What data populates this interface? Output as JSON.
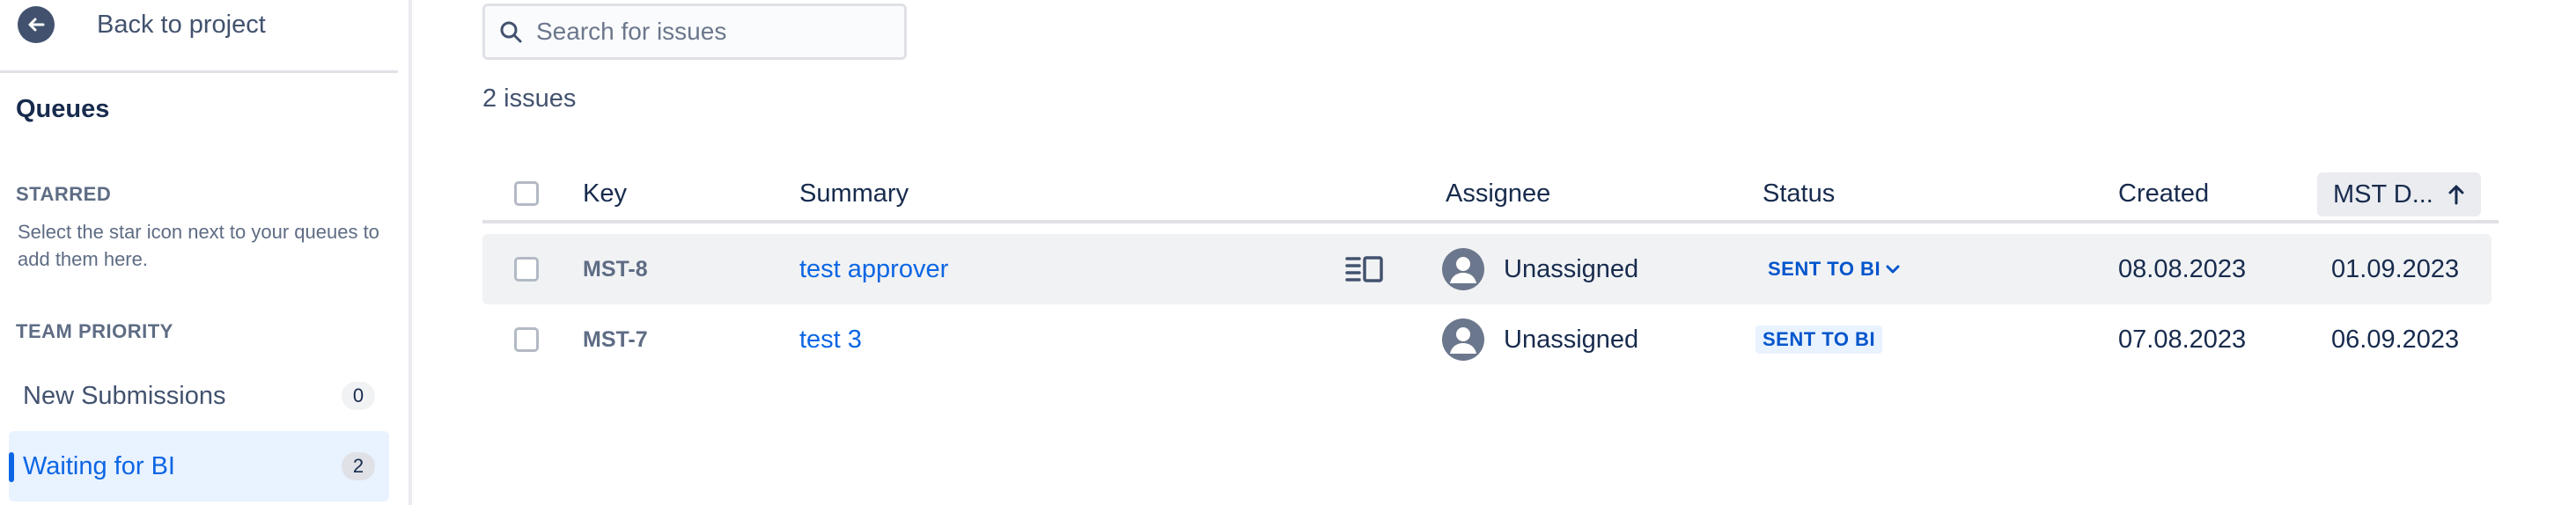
{
  "sidebar": {
    "back_label": "Back to project",
    "queues_title": "Queues",
    "starred_head": "STARRED",
    "starred_hint": "Select the star icon next to your queues to add them here.",
    "team_priority_head": "TEAM PRIORITY",
    "queues": [
      {
        "label": "New Submissions",
        "count": "0",
        "active": false
      },
      {
        "label": "Waiting for BI",
        "count": "2",
        "active": true
      }
    ]
  },
  "search": {
    "placeholder": "Search for issues",
    "value": ""
  },
  "issue_count": "2 issues",
  "table": {
    "headers": {
      "key": "Key",
      "summary": "Summary",
      "assignee": "Assignee",
      "status": "Status",
      "created": "Created",
      "due": "MST D..."
    },
    "rows": [
      {
        "key": "MST-8",
        "summary": "test approver",
        "assignee": "Unassigned",
        "status": "SENT TO BI",
        "created": "08.08.2023",
        "due": "01.09.2023"
      },
      {
        "key": "MST-7",
        "summary": "test 3",
        "assignee": "Unassigned",
        "status": "SENT TO BI",
        "created": "07.08.2023",
        "due": "06.09.2023"
      }
    ]
  },
  "colors": {
    "accent": "#0c66e4",
    "status_bg": "#e9f2ff",
    "status_text": "#0055cc"
  }
}
